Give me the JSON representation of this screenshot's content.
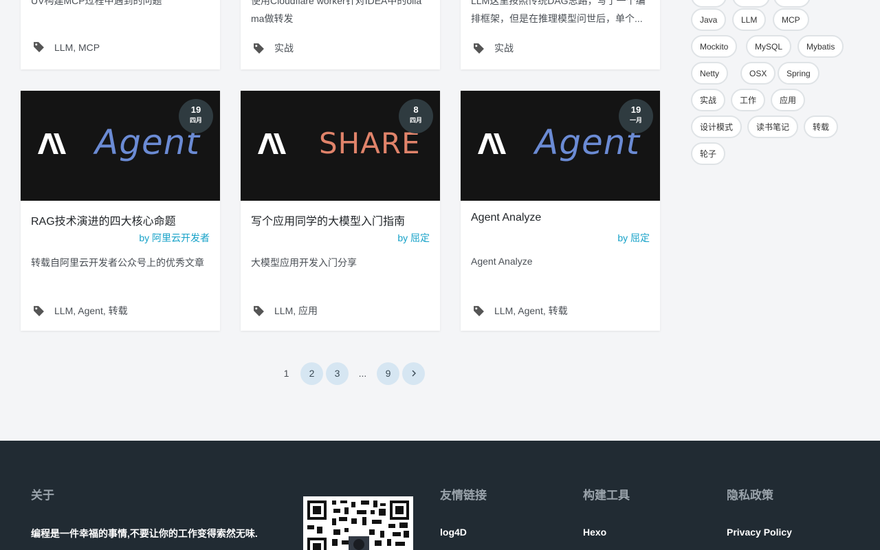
{
  "top_cards": [
    {
      "excerpt": "UV构建MCP过程中遇到的问题",
      "tags": "LLM, MCP"
    },
    {
      "excerpt_line1": "使用Cloudflare worker针对IDEA中的olla",
      "excerpt_line2": "ma做转发",
      "tags": "实战"
    },
    {
      "excerpt_line1": "LLM这里按照传统DAG思路，写了一个编",
      "excerpt_line2": "排框架，但是在推理模型问世后，单个...",
      "tags": "实战"
    }
  ],
  "cards": [
    {
      "day": "19",
      "month": "四月",
      "thumb_word": "Agent",
      "title": "RAG技术演进的四大核心命题",
      "author_prefix": "by",
      "author": "阿里云开发者",
      "desc": "转载自阿里云开发者公众号上的优秀文章",
      "tags": "LLM, Agent, 转载"
    },
    {
      "day": "8",
      "month": "四月",
      "thumb_word": "SHARE",
      "title": "写个应用同学的大模型入门指南",
      "author_prefix": "by",
      "author": "屈定",
      "desc": "大模型应用开发入门分享",
      "tags": "LLM, 应用"
    },
    {
      "day": "19",
      "month": "一月",
      "thumb_word": "Agent",
      "title": "Agent Analyze",
      "author_prefix": "by",
      "author": "屈定",
      "desc": "Agent Analyze",
      "tags": "LLM, Agent, 转载"
    }
  ],
  "pagination": {
    "current": "1",
    "p2": "2",
    "p3": "3",
    "dots": "...",
    "last": "9",
    "next_icon": "chevron-right-icon"
  },
  "tagcloud": [
    "Java",
    "LLM",
    "MCP",
    "Mockito",
    "MySQL",
    "Mybatis",
    "Netty",
    "OSX",
    "Spring",
    "实战",
    "工作",
    "应用",
    "设计模式",
    "读书笔记",
    "转载",
    "轮子"
  ],
  "footer": {
    "about_title": "关于",
    "about_text": "编程是一件幸福的事情,不要让你的工作变得索然无味.",
    "links_title": "友情链接",
    "links_first": "log4D",
    "build_title": "构建工具",
    "build_first": "Hexo",
    "privacy_title": "隐私政策",
    "privacy_first": "Privacy Policy"
  },
  "colors": {
    "accent": "#17a2c8",
    "footer_bg": "#212b33",
    "badge_bg": "#2f3b40",
    "thumb_agent": "#6b8bd4",
    "thumb_share": "#e0836a"
  }
}
